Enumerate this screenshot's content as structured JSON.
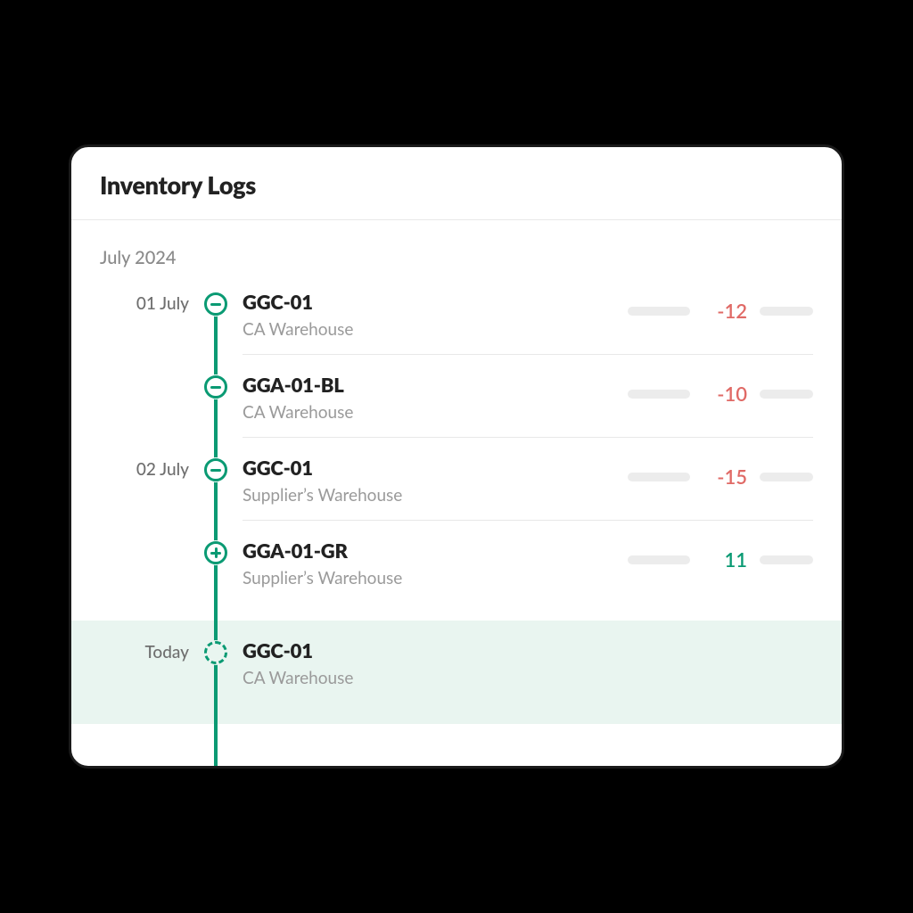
{
  "title": "Inventory Logs",
  "month_label": "July 2024",
  "logs": [
    {
      "date": "01 July",
      "sku": "GGC-01",
      "warehouse": "CA Warehouse",
      "delta": "-12",
      "direction": "neg",
      "icon": "minus"
    },
    {
      "date": "",
      "sku": "GGA-01-BL",
      "warehouse": "CA Warehouse",
      "delta": "-10",
      "direction": "neg",
      "icon": "minus"
    },
    {
      "date": "02 July",
      "sku": "GGC-01",
      "warehouse": "Supplier’s Warehouse",
      "delta": "-15",
      "direction": "neg",
      "icon": "minus"
    },
    {
      "date": "",
      "sku": "GGA-01-GR",
      "warehouse": "Supplier’s Warehouse",
      "delta": "11",
      "direction": "pos",
      "icon": "plus"
    }
  ],
  "today": {
    "date_label": "Today",
    "sku": "GGC-01",
    "warehouse": "CA Warehouse"
  },
  "colors": {
    "accent": "#0a9a73",
    "negative": "#e06a66",
    "today_bg": "#e9f5f0"
  }
}
